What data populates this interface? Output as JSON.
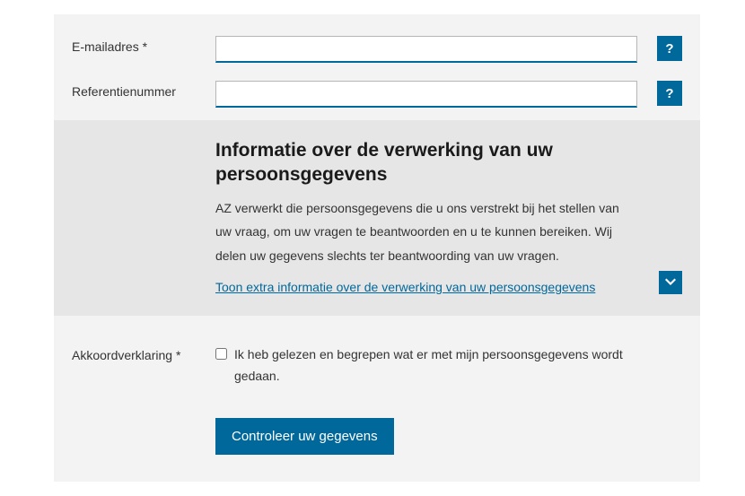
{
  "fields": {
    "email": {
      "label": "E-mailadres *",
      "value": ""
    },
    "reference": {
      "label": "Referentienummer",
      "value": ""
    }
  },
  "help_symbol": "?",
  "info": {
    "title": "Informatie over de verwerking van uw persoonsgegevens",
    "body": "AZ verwerkt die persoonsgegevens die u ons verstrekt bij het stellen van uw vraag, om uw vragen te beantwoorden en u te kunnen bereiken. Wij delen uw gegevens slechts ter beantwoording van uw vragen.",
    "link": "Toon extra informatie over de verwerking van uw persoonsgegevens"
  },
  "consent": {
    "label": "Akkoordverklaring *",
    "text": "Ik heb gelezen en begrepen wat er met mijn persoonsgegevens wordt gedaan."
  },
  "submit": {
    "label": "Controleer uw gegevens"
  }
}
